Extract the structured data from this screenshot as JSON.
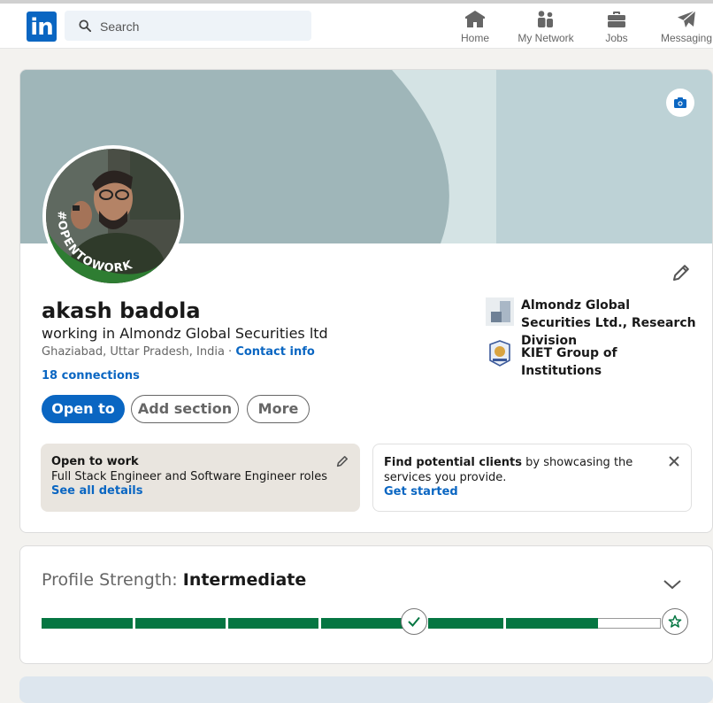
{
  "nav": {
    "logo_text": "in",
    "search_placeholder": "Search",
    "items": [
      {
        "label": "Home",
        "icon": "home-icon"
      },
      {
        "label": "My Network",
        "icon": "network-icon"
      },
      {
        "label": "Jobs",
        "icon": "briefcase-icon"
      },
      {
        "label": "Messaging",
        "icon": "send-icon"
      }
    ]
  },
  "profile": {
    "name": "akash badola",
    "headline": "working in Almondz Global Securities ltd",
    "location": "Ghaziabad, Uttar Pradesh, India",
    "separator": " · ",
    "contact_label": "Contact info",
    "connections": "18 connections",
    "avatar_badge": "#OPENTOWORK",
    "buttons": {
      "open_to": "Open to",
      "add_section": "Add section",
      "more": "More"
    },
    "organizations": [
      {
        "name": "Almondz Global Securities Ltd., Research Division",
        "icon": "company-logo-icon"
      },
      {
        "name": "KIET Group of Institutions",
        "icon": "school-logo-icon"
      }
    ],
    "open_to_work": {
      "title": "Open to work",
      "roles": "Full Stack Engineer and Software Engineer roles",
      "link": "See all details"
    },
    "clients": {
      "bold": "Find potential clients",
      "rest": " by showcasing the services you provide.",
      "link": "Get started"
    }
  },
  "strength": {
    "label": "Profile Strength: ",
    "level": "Intermediate",
    "progress": 0.88
  },
  "colors": {
    "brand": "#0a66c2",
    "progress": "#057642",
    "banner": "#b8cfd2"
  }
}
